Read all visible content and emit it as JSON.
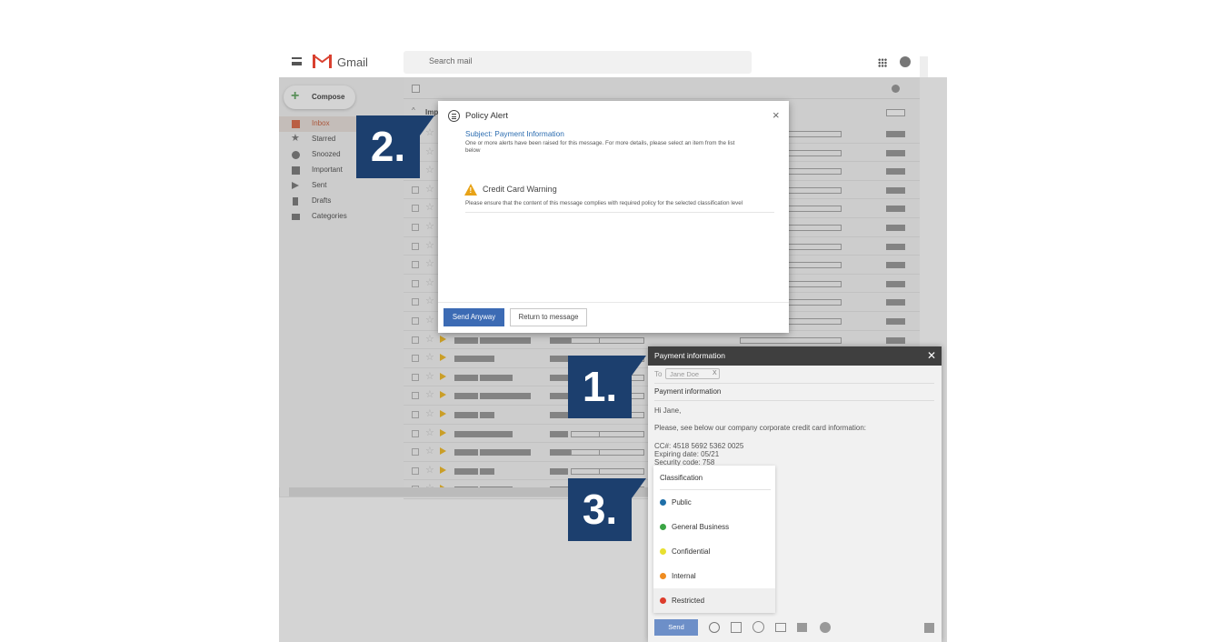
{
  "app": {
    "name": "Gmail",
    "search_placeholder": "Search mail"
  },
  "sidebar": {
    "compose_label": "Compose",
    "items": [
      {
        "label": "Inbox",
        "icon": "inbox-icon",
        "color": "#d9532c"
      },
      {
        "label": "Starred",
        "icon": "star-icon",
        "color": "#666666"
      },
      {
        "label": "Snoozed",
        "icon": "clock-icon",
        "color": "#666666"
      },
      {
        "label": "Important",
        "icon": "important-icon",
        "color": "#666666"
      },
      {
        "label": "Sent",
        "icon": "send-icon",
        "color": "#666666"
      },
      {
        "label": "Drafts",
        "icon": "draft-icon",
        "color": "#666666"
      },
      {
        "label": "Categories",
        "icon": "label-icon",
        "color": "#666666"
      }
    ]
  },
  "list": {
    "section_label": "Imp"
  },
  "policy_dialog": {
    "title": "Policy Alert",
    "subject": "Subject: Payment Information",
    "description": "One or more alerts have been raised for this message. For more details, please select an item from the list below",
    "warning_title": "Credit Card Warning",
    "warning_text": "Please ensure that the content of this message complies with required policy for the selected classification level",
    "send_anyway_label": "Send Anyway",
    "return_label": "Return to message",
    "close_glyph": "×",
    "accent": "#3c6bb4"
  },
  "compose_window": {
    "title": "Payment information",
    "close_glyph": "✕",
    "to_label": "To",
    "recipient": "Jane Doe",
    "recipient_remove": "X",
    "subject": "Payment information",
    "greeting": "Hi Jane,",
    "intro": "Please, see below our company corporate credit card information:",
    "cc_number": "CC#: 4518 5692 5362 0025",
    "expiry": "Expiring date: 05/21",
    "security_code": "Security code: 758",
    "send_label": "Send"
  },
  "classification_menu": {
    "header": "Classification",
    "options": [
      {
        "label": "Public",
        "color": "#1f6fa8"
      },
      {
        "label": "General Business",
        "color": "#3aa544"
      },
      {
        "label": "Confidential",
        "color": "#e8e030"
      },
      {
        "label": "Internal",
        "color": "#ef8c21"
      },
      {
        "label": "Restricted",
        "color": "#dd3c2c"
      }
    ]
  },
  "callouts": {
    "step1": "1.",
    "step2": "2.",
    "step3": "3."
  }
}
